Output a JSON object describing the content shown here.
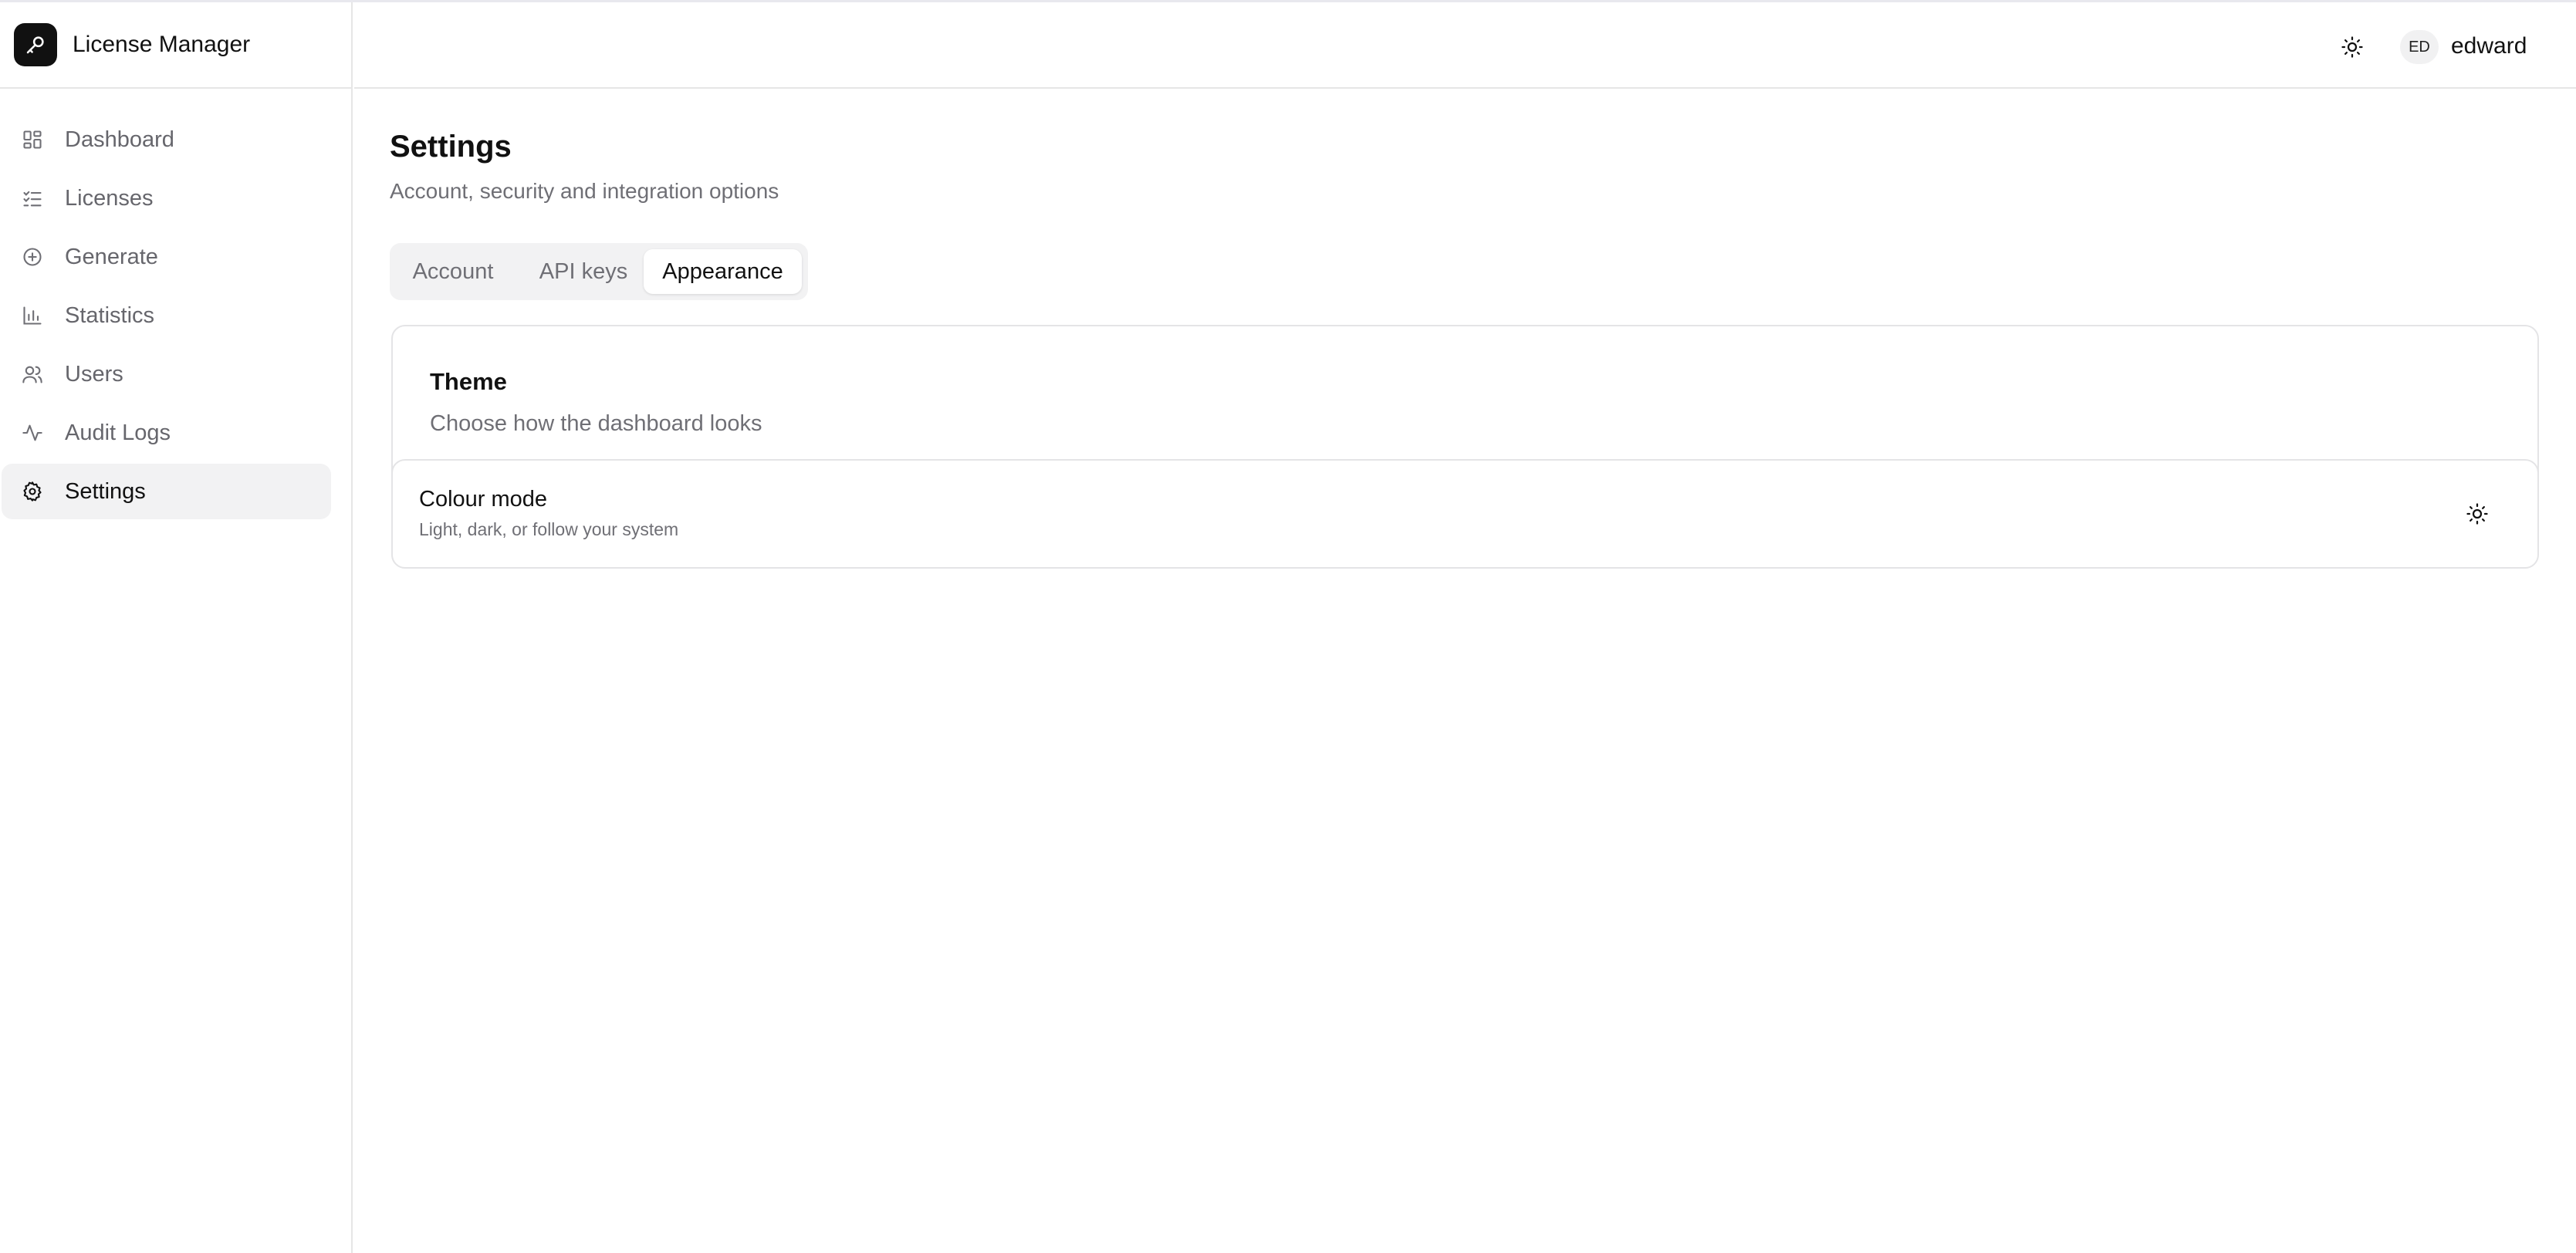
{
  "app": {
    "name": "License Manager",
    "logo_icon": "key-icon"
  },
  "sidebar": {
    "items": [
      {
        "label": "Dashboard",
        "icon": "dashboard-grid-icon",
        "active": false
      },
      {
        "label": "Licenses",
        "icon": "checklist-icon",
        "active": false
      },
      {
        "label": "Generate",
        "icon": "plus-circle-icon",
        "active": false
      },
      {
        "label": "Statistics",
        "icon": "bar-chart-icon",
        "active": false
      },
      {
        "label": "Users",
        "icon": "users-icon",
        "active": false
      },
      {
        "label": "Audit Logs",
        "icon": "activity-icon",
        "active": false
      },
      {
        "label": "Settings",
        "icon": "gear-icon",
        "active": true
      }
    ]
  },
  "header": {
    "theme_icon": "sun-icon",
    "user": {
      "initials": "ED",
      "name": "edward"
    }
  },
  "page": {
    "title": "Settings",
    "subtitle": "Account, security and integration options"
  },
  "tabs": [
    {
      "label": "Account",
      "active": false
    },
    {
      "label": "API keys",
      "active": false
    },
    {
      "label": "Appearance",
      "active": true
    }
  ],
  "theme_card": {
    "title": "Theme",
    "description": "Choose how the dashboard looks",
    "colour_mode": {
      "title": "Colour mode",
      "description": "Light, dark, or follow your system",
      "icon": "sun-icon"
    }
  },
  "colors": {
    "accent": "#111111",
    "active_bg": "#f2f2f3",
    "muted_text": "#6f6f75",
    "border": "#e4e4e6"
  }
}
